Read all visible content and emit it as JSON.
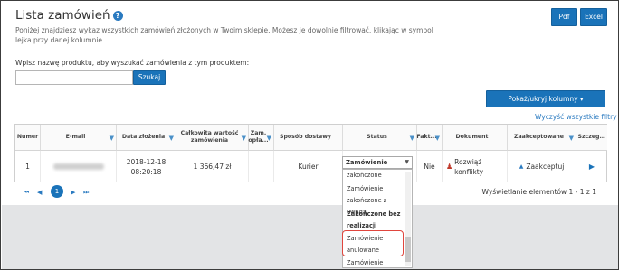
{
  "header": {
    "title": "Lista zamówień",
    "help_glyph": "?",
    "description": "Poniżej znajdziesz wykaz wszystkich zamówień złożonych w Twoim sklepie. Możesz je dowolnie filtrować, klikając w symbol lejka przy danej kolumnie.",
    "pdf_label": "Pdf",
    "excel_label": "Excel"
  },
  "search": {
    "label": "Wpisz nazwę produktu, aby wyszukać zamówienia z tym produktem:",
    "value": "",
    "placeholder": "",
    "button_label": "Szukaj"
  },
  "toolbar": {
    "columns_button": "Pokaż/ukryj kolumny ▾",
    "clear_filters": "Wyczyść wszystkie filtry"
  },
  "table": {
    "headers": {
      "numer": "Numer",
      "email": "E-mail",
      "data": "Data złożenia",
      "wartosc": "Całkowita wartość zamówienia",
      "zam_opla": "Zam. opła...",
      "dostawa": "Sposób dostawy",
      "status": "Status",
      "fakt": "Fakt...",
      "dokument": "Dokument",
      "zaakceptowane": "Zaakceptowane",
      "szczeg": "Szczeg..."
    },
    "row": {
      "numer": "1",
      "data": "2018-12-18 08:20:18",
      "wartosc": "1 366,47 zł",
      "dostawa": "Kurier",
      "status_value": "Zamówienie",
      "fakt": "Nie",
      "dokument": "Rozwiąż konflikty",
      "zaakceptowane": "Zaakceptuj"
    }
  },
  "pager": {
    "current_page": "1",
    "info": "Wyświetlanie elementów 1 - 1 z 1"
  },
  "status_dropdown": {
    "items": [
      "zakończone",
      "Zamówienie",
      "zakończone z uwagą",
      "Zakończone bez",
      "realizacji",
      "Zamówienie",
      "anulowane",
      "Zamówienie zwrócone"
    ]
  },
  "colors": {
    "accent": "#1a73b9",
    "highlight": "#e0463e",
    "funnel": "#4a90c8"
  }
}
